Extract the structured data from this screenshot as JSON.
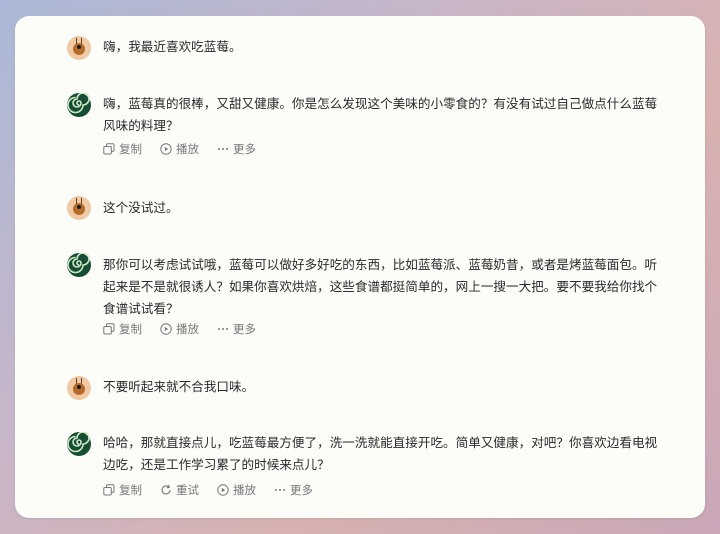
{
  "conversation": [
    {
      "role": "user",
      "text": "嗨，我最近喜欢吃蓝莓。"
    },
    {
      "role": "assistant",
      "text": "嗨，蓝莓真的很棒，又甜又健康。你是怎么发现这个美味的小零食的？有没有试过自己做点什么蓝莓风味的料理？",
      "actions": [
        "复制",
        "播放",
        "更多"
      ]
    },
    {
      "role": "user",
      "text": "这个没试过。"
    },
    {
      "role": "assistant",
      "text": "那你可以考虑试试哦，蓝莓可以做好多好吃的东西，比如蓝莓派、蓝莓奶昔，或者是烤蓝莓面包。听起来是不是就很诱人？如果你喜欢烘焙，这些食谱都挺简单的，网上一搜一大把。要不要我给你找个食谱试试看？",
      "actions": [
        "复制",
        "播放",
        "更多"
      ]
    },
    {
      "role": "user",
      "text": "不要听起来就不合我口味。"
    },
    {
      "role": "assistant",
      "text": "哈哈，那就直接点儿，吃蓝莓最方便了，洗一洗就能直接开吃。简单又健康，对吧？你喜欢边看电视边吃，还是工作学习累了的时候来点儿？",
      "actions": [
        "复制",
        "重试",
        "播放",
        "更多"
      ]
    }
  ],
  "icons": {
    "copy": "copy-icon",
    "retry": "refresh-icon",
    "play": "play-icon",
    "more": "more-icon",
    "user_avatar": "bee-avatar",
    "assistant_avatar": "spiral-avatar"
  },
  "colors": {
    "window_bg": "#fcfcf8",
    "text": "#2a2a2a",
    "action_text": "#777777",
    "assistant_avatar_bg": "#174d33",
    "user_avatar_bg": "#f1c9a4"
  }
}
